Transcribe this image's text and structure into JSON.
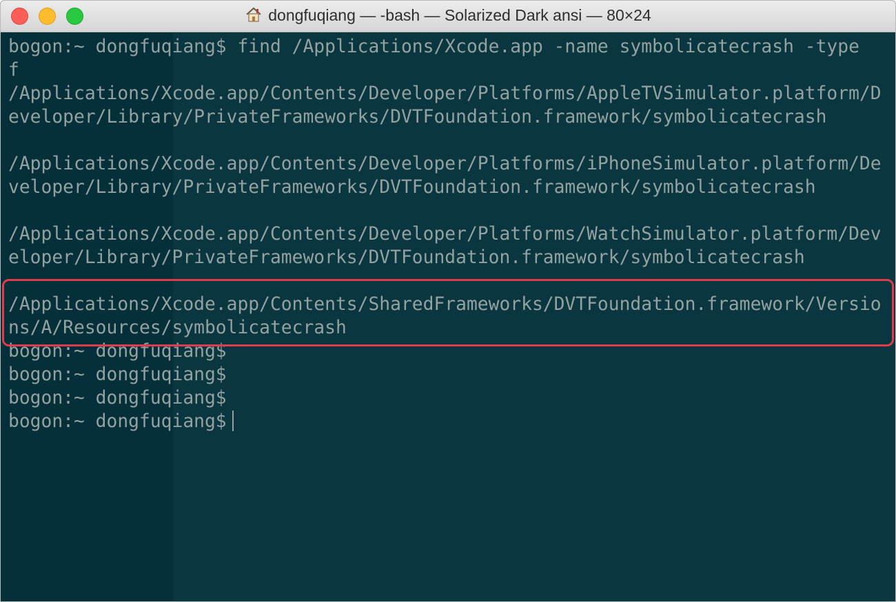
{
  "window": {
    "title": "dongfuqiang — -bash — Solarized Dark ansi — 80×24",
    "title_icon": "home-icon"
  },
  "terminal": {
    "prompt": "bogon:~ dongfuqiang$",
    "command": "find /Applications/Xcode.app -name symbolicatecrash -type",
    "lines": [
      "bogon:~ dongfuqiang$ find /Applications/Xcode.app -name symbolicatecrash -type",
      "f",
      "/Applications/Xcode.app/Contents/Developer/Platforms/AppleTVSimulator.platform/D",
      "eveloper/Library/PrivateFrameworks/DVTFoundation.framework/symbolicatecrash",
      "",
      "/Applications/Xcode.app/Contents/Developer/Platforms/iPhoneSimulator.platform/De",
      "veloper/Library/PrivateFrameworks/DVTFoundation.framework/symbolicatecrash",
      "",
      "/Applications/Xcode.app/Contents/Developer/Platforms/WatchSimulator.platform/Dev",
      "eloper/Library/PrivateFrameworks/DVTFoundation.framework/symbolicatecrash",
      "",
      "/Applications/Xcode.app/Contents/SharedFrameworks/DVTFoundation.framework/Versio",
      "ns/A/Resources/symbolicatecrash",
      "bogon:~ dongfuqiang$",
      "bogon:~ dongfuqiang$",
      "bogon:~ dongfuqiang$",
      "bogon:~ dongfuqiang$ "
    ],
    "highlight_color": "#e03b4a",
    "text_color": "#93a1a1",
    "background_color": "#05303a"
  }
}
